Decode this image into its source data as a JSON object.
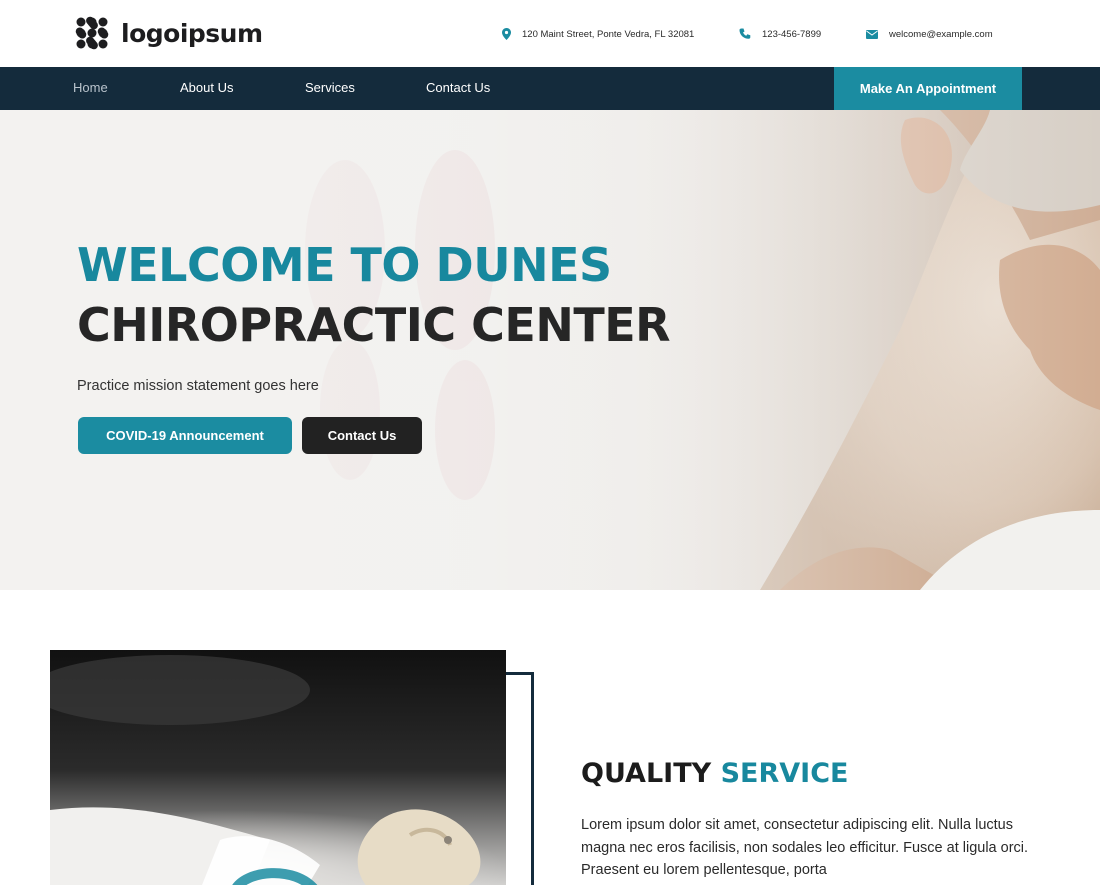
{
  "header": {
    "logo": {
      "text": "logoipsum"
    },
    "contacts": {
      "address": "120 Maint Street, Ponte Vedra, FL 32081",
      "phone": "123-456-7899",
      "email": "welcome@example.com"
    },
    "icons": {
      "address": "map-pin-icon",
      "phone": "phone-icon",
      "email": "envelope-icon"
    }
  },
  "nav": {
    "items": [
      {
        "label": "Home",
        "active": true
      },
      {
        "label": "About Us"
      },
      {
        "label": "Services"
      },
      {
        "label": "Contact Us"
      }
    ],
    "cta_label": "Make An Appointment"
  },
  "hero": {
    "title_line1": "WELCOME TO DUNES",
    "title_line2": "CHIROPRACTIC CENTER",
    "subtitle": "Practice mission statement goes here",
    "primary_button": "COVID-19 Announcement",
    "secondary_button": "Contact Us"
  },
  "quality": {
    "title_word1": "QUALITY",
    "title_word2": "SERVICE",
    "body": "Lorem ipsum dolor sit amet, consectetur adipiscing elit. Nulla luctus magna nec eros facilisis, non sodales leo efficitur. Fusce at ligula orci. Praesent eu lorem pellentesque, porta"
  },
  "colors": {
    "accent": "#1b8ca1",
    "nav_bg": "#142b3c",
    "dark_button": "#222222"
  }
}
